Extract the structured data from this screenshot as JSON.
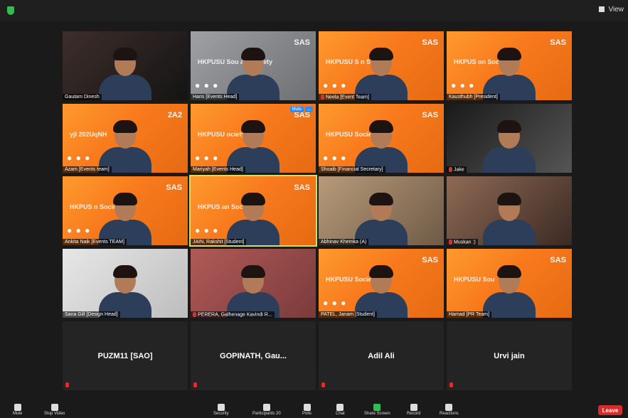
{
  "window": {
    "view_label": "View"
  },
  "participants": [
    {
      "name": "Gautam Dinesh",
      "bg": "photo",
      "dots": false,
      "muted": false
    },
    {
      "name": "Haris [Events Head]",
      "bg": "gray",
      "dots": true,
      "muted": false,
      "banner": "HKPUSU Sou   an Society",
      "logo": "SAS"
    },
    {
      "name": "Neela [Event Team]",
      "bg": "sas",
      "dots": true,
      "muted": true,
      "banner": "HKPUSU S   n Society",
      "logo": "SAS"
    },
    {
      "name": "Kausthubh [President]",
      "bg": "sas",
      "dots": true,
      "muted": false,
      "banner": "HKPUS   on Society",
      "logo": "SAS"
    },
    {
      "name": "Azam [Events team]",
      "bg": "sas",
      "dots": true,
      "muted": false,
      "banner": "yjI 202UqNH",
      "logo": "2A2"
    },
    {
      "name": "Mariyah [Events Head]",
      "bg": "sas",
      "dots": true,
      "muted": false,
      "banner": "HKPUSU   ociety",
      "logo": "SAS",
      "mute_btn": "Mute",
      "more_btn": "..."
    },
    {
      "name": "Shoaib [Financial Secretary]",
      "bg": "sas",
      "dots": true,
      "muted": false,
      "banner": "HKPUSU   Society",
      "logo": "SAS"
    },
    {
      "name": "Jake",
      "bg": "photo2",
      "dots": false,
      "muted": true
    },
    {
      "name": "Ankita Naik [Events TEAM]",
      "bg": "sas",
      "dots": true,
      "muted": false,
      "banner": "HKPUS   n Society",
      "logo": "SAS"
    },
    {
      "name": "JAIN, Rakshit [Student]",
      "bg": "sas",
      "dots": true,
      "muted": false,
      "banner": "HKPUS   an Society",
      "logo": "SAS",
      "highlight": true
    },
    {
      "name": "Abhinav Khemka (A)",
      "bg": "room",
      "dots": false,
      "muted": false
    },
    {
      "name": "Muskan :)",
      "bg": "room2",
      "dots": false,
      "muted": true
    },
    {
      "name": "Sana Gill [Design Head]",
      "bg": "wall",
      "dots": false,
      "muted": false
    },
    {
      "name": "PERERA, Galhenage Kavindi R...",
      "bg": "pink",
      "dots": false,
      "muted": true
    },
    {
      "name": "PATEL, Janam [Student]",
      "bg": "sas",
      "dots": true,
      "muted": false,
      "banner": "HKPUSU   Society",
      "logo": "SAS"
    },
    {
      "name": "Hamad [PR Team]",
      "bg": "sas",
      "dots": false,
      "muted": false,
      "banner": "HKPUSU Sou",
      "logo": "SAS"
    }
  ],
  "name_only": [
    {
      "name": "PUZM11 [SAO]"
    },
    {
      "name": "GOPINATH,  Gau..."
    },
    {
      "name": "Adil Ali"
    },
    {
      "name": "Urvi jain"
    }
  ],
  "bottom": {
    "mute": "Mute",
    "stop_video": "Stop Video",
    "security": "Security",
    "participants": "Participants",
    "participant_count": "20",
    "polls": "Polls",
    "chat": "Chat",
    "share": "Share Screen",
    "record": "Record",
    "reactions": "Reactions",
    "leave": "Leave"
  },
  "colors": {
    "accent": "#2d8cff",
    "leave": "#d72c2c",
    "sas_orange": "#f87a1d",
    "speaker_highlight": "#c9e36a"
  }
}
